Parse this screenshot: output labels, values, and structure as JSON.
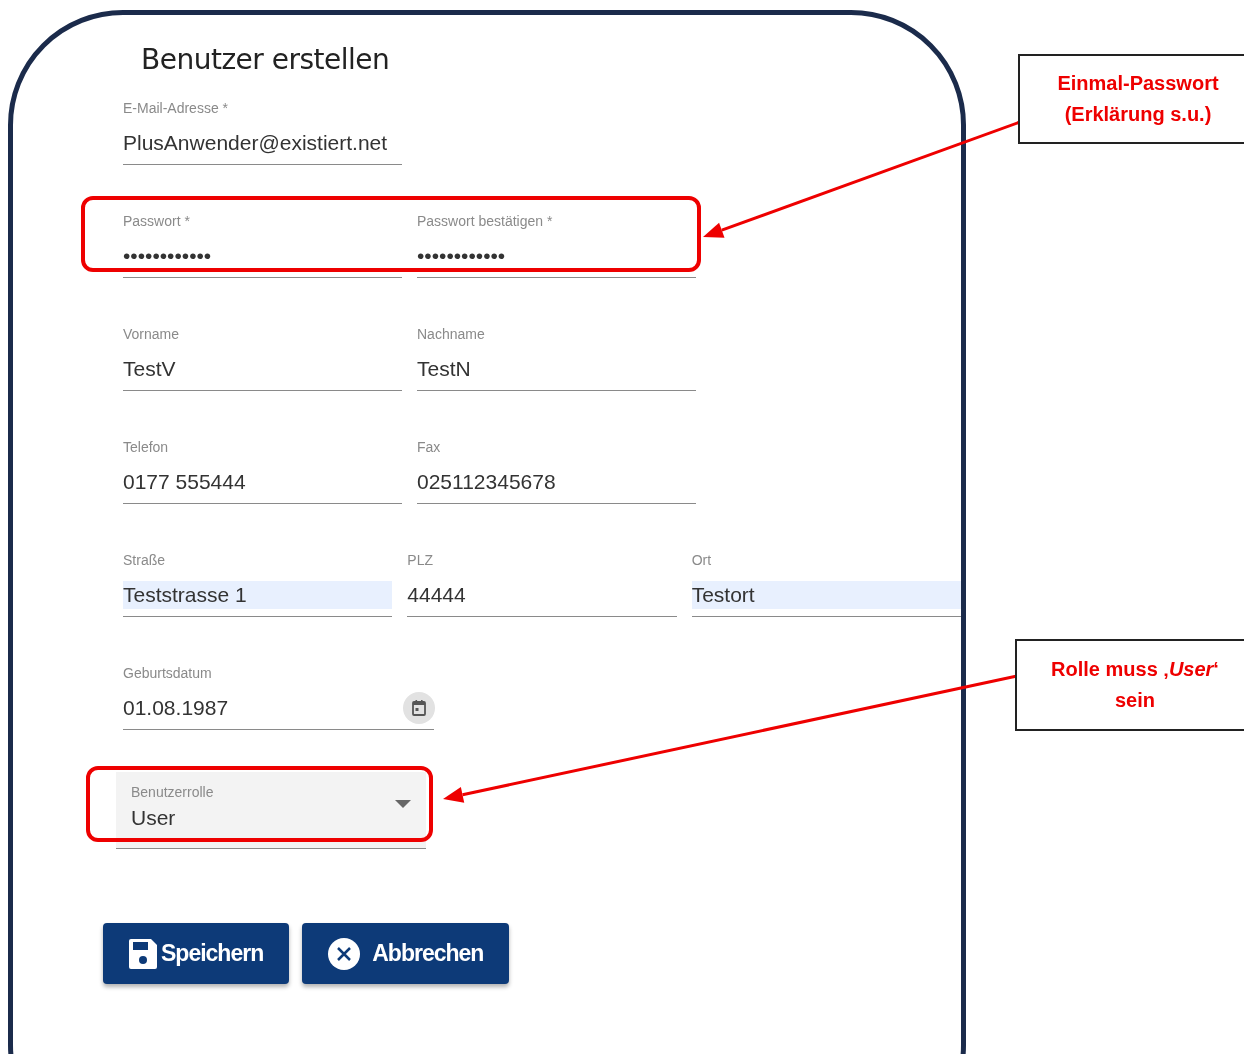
{
  "form": {
    "title": "Benutzer erstellen",
    "rows": [
      {
        "highlighted": false,
        "fields": [
          {
            "label": "E-Mail-Adresse *",
            "value": "PlusAnwender@existiert.net",
            "autofilled": false
          }
        ]
      },
      {
        "highlighted": true,
        "fields": [
          {
            "label": "Passwort *",
            "value": "••••••••••••",
            "autofilled": false
          },
          {
            "label": "Passwort bestätigen *",
            "value": "••••••••••••",
            "autofilled": false
          }
        ]
      },
      {
        "highlighted": false,
        "fields": [
          {
            "label": "Vorname",
            "value": "TestV",
            "autofilled": false
          },
          {
            "label": "Nachname",
            "value": "TestN",
            "autofilled": false
          }
        ]
      },
      {
        "highlighted": false,
        "fields": [
          {
            "label": "Telefon",
            "value": "0177 555444",
            "autofilled": false
          },
          {
            "label": "Fax",
            "value": "025112345678",
            "autofilled": false
          }
        ]
      },
      {
        "highlighted": false,
        "fields": [
          {
            "label": "Straße",
            "value": "Teststrasse 1",
            "autofilled": true
          },
          {
            "label": "PLZ",
            "value": "44444",
            "autofilled": false
          },
          {
            "label": "Ort",
            "value": "Testort",
            "autofilled": true
          }
        ]
      }
    ],
    "date_field": {
      "label": "Geburtsdatum",
      "value": "01.08.1987"
    },
    "role_select": {
      "label": "Benutzerrolle",
      "value": "User",
      "highlighted": true
    },
    "buttons": [
      {
        "kind": "save",
        "label": "Speichern"
      },
      {
        "kind": "cancel",
        "label": "Abbrechen"
      }
    ]
  },
  "annotations": [
    {
      "text": "Einmal-Passwort (Erklärung s.u.)"
    },
    {
      "text": "Rolle muss ‚*User*‘ sein"
    }
  ]
}
